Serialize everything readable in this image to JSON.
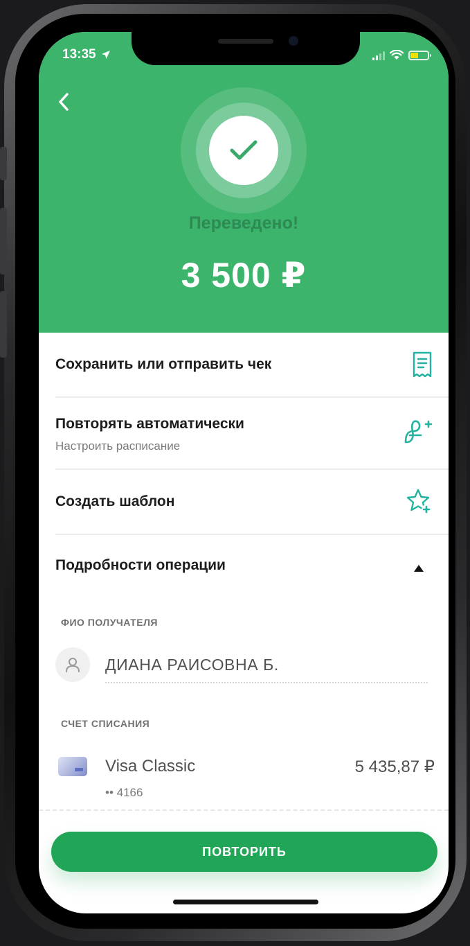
{
  "status_bar": {
    "time": "13:35",
    "location_icon": "location-arrow-icon",
    "signal_icon": "cellular-signal-icon",
    "wifi_icon": "wifi-icon",
    "battery_icon": "battery-icon",
    "battery_level": 0.45,
    "battery_color": "#f3e200"
  },
  "hero": {
    "back_icon": "chevron-left-icon",
    "success_icon": "checkmark-icon",
    "status": "Переведено!",
    "amount": "3 500 ₽",
    "background": "#3cb46b"
  },
  "actions": [
    {
      "title": "Сохранить или отправить чек",
      "subtitle": "",
      "icon": "receipt-icon"
    },
    {
      "title": "Повторять автоматически",
      "subtitle": "Настроить расписание",
      "icon": "schedule-repeat-icon"
    },
    {
      "title": "Создать шаблон",
      "subtitle": "",
      "icon": "star-plus-icon"
    }
  ],
  "details": {
    "title": "Подробности операции",
    "toggle_icon": "triangle-up-icon",
    "recipient_label": "ФИО ПОЛУЧАТЕЛЯ",
    "recipient_icon": "person-icon",
    "recipient_name": "ДИАНА РАИСОВНА Б.",
    "account_label": "СЧЕТ СПИСАНИЯ",
    "card_icon": "bank-card-icon",
    "card_name": "Visa Classic",
    "card_number": "•• 4166",
    "card_balance": "5 435,87 ₽"
  },
  "footer": {
    "repeat_button": "ПОВТОРИТЬ",
    "accent": "#20a656"
  }
}
